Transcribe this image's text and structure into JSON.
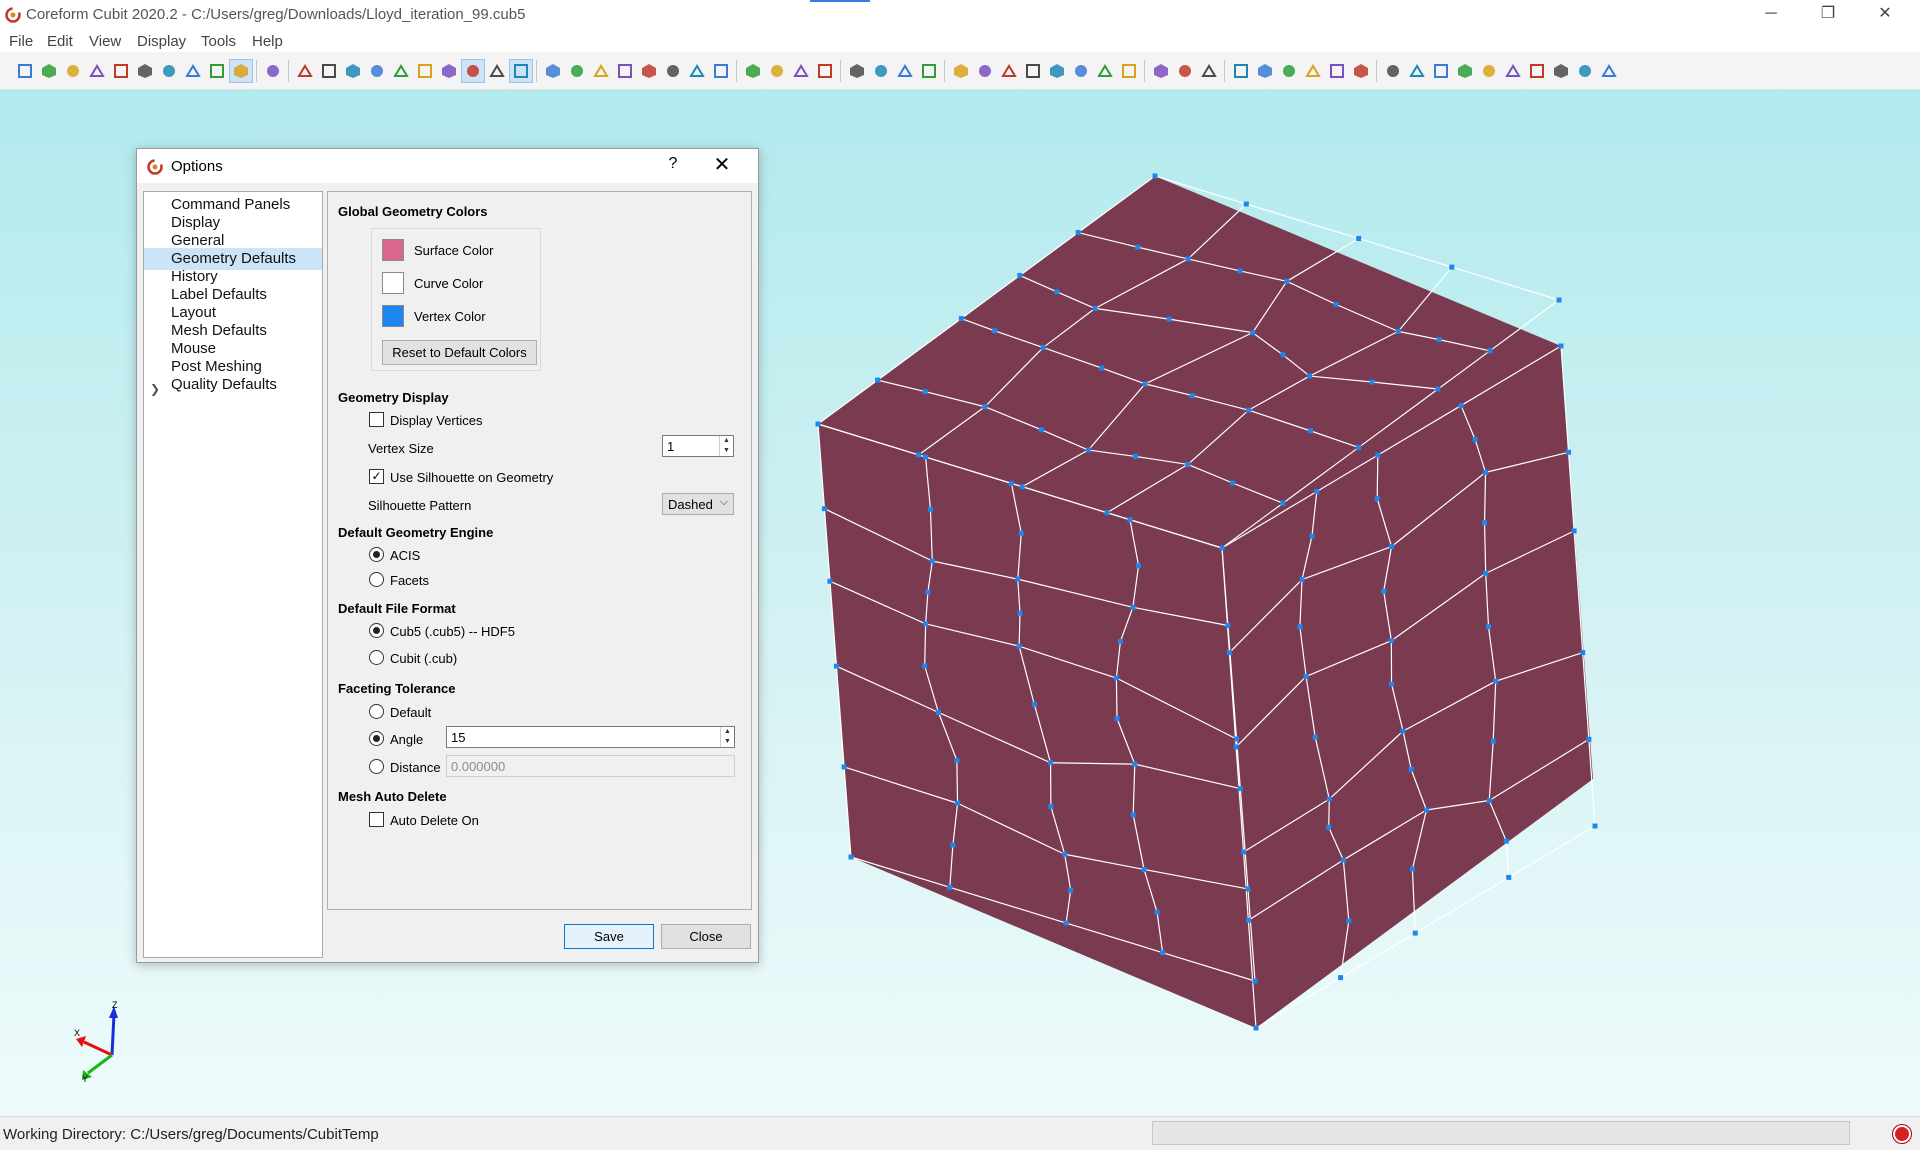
{
  "window": {
    "title": "Coreform Cubit 2020.2 - C:/Users/greg/Downloads/Lloyd_iteration_99.cub5",
    "min_label": "─",
    "max_label": "❐",
    "close_label": "✕"
  },
  "menu": [
    "File",
    "Edit",
    "View",
    "Display",
    "Tools",
    "Help"
  ],
  "toolbar_icons": [
    "new-file-icon",
    "open-folder-icon",
    "save-icon",
    "save-as-icon",
    "export-icon",
    "journal-icon",
    "play-icon",
    "record-icon",
    "tools-icon",
    "select-icon",
    "undo-icon",
    "wireframe-icon",
    "hidden-line-icon",
    "shaded-icon",
    "smooth-shade-icon",
    "assembly-icon",
    "mesh-view-icon",
    "geometry-view-icon",
    "grid-icon",
    "pick-volume-icon",
    "pick-surface-icon",
    "refresh-icon",
    "zoom-in-icon",
    "zoom-out-icon",
    "rotate-icon",
    "perspective-icon",
    "clip-icon",
    "face-icon",
    "volume-box-icon",
    "transparency-icon",
    "isometric-icon",
    "sphere-icon",
    "cylinder-icon",
    "brick-icon",
    "frustum-icon",
    "torus-icon",
    "boolean-icon",
    "vertex-pick-icon",
    "edge-pick-icon",
    "surface-pick-icon",
    "volume-pick-icon",
    "body-pick-icon",
    "group-pick-icon",
    "curve-icon",
    "point-icon",
    "add-vertex-icon",
    "add-curve-icon",
    "add-surface-icon",
    "add-volume-icon",
    "webcut-icon",
    "imprint-icon",
    "merge-icon",
    "split-icon",
    "measure-icon",
    "probe-icon",
    "sweep-icon",
    "label-icon",
    "quality-icon",
    "mesh-icon",
    "compare-icon",
    "fit-icon",
    "zoom-box-icon",
    "more-icon",
    "pin-icon"
  ],
  "status": {
    "working_directory": "Working Directory: C:/Users/greg/Documents/CubitTemp"
  },
  "dialog": {
    "title": "Options",
    "help_label": "?",
    "close_label": "✕",
    "nav": [
      {
        "label": "Command Panels",
        "selected": false
      },
      {
        "label": "Display",
        "selected": false
      },
      {
        "label": "General",
        "selected": false
      },
      {
        "label": "Geometry Defaults",
        "selected": true
      },
      {
        "label": "History",
        "selected": false
      },
      {
        "label": "Label Defaults",
        "selected": false
      },
      {
        "label": "Layout",
        "selected": false
      },
      {
        "label": "Mesh Defaults",
        "selected": false
      },
      {
        "label": "Mouse",
        "selected": false
      },
      {
        "label": "Post Meshing",
        "selected": false
      },
      {
        "label": "Quality Defaults",
        "selected": false,
        "expandable": true
      }
    ],
    "global_colors": {
      "heading": "Global Geometry Colors",
      "surface_label": "Surface Color",
      "surface_color": "#d9668c",
      "curve_label": "Curve Color",
      "curve_color": "#ffffff",
      "vertex_label": "Vertex Color",
      "vertex_color": "#1e86f0",
      "reset_label": "Reset to Default Colors"
    },
    "geometry_display": {
      "heading": "Geometry Display",
      "display_vertices_label": "Display Vertices",
      "display_vertices_checked": false,
      "vertex_size_label": "Vertex Size",
      "vertex_size_value": "1",
      "silhouette_label": "Use Silhouette on Geometry",
      "silhouette_checked": true,
      "pattern_label": "Silhouette Pattern",
      "pattern_value": "Dashed"
    },
    "engine": {
      "heading": "Default Geometry Engine",
      "options": [
        "ACIS",
        "Facets"
      ],
      "selected": "ACIS"
    },
    "file_format": {
      "heading": "Default File Format",
      "options": [
        "Cub5 (.cub5) -- HDF5",
        "Cubit (.cub)"
      ],
      "selected": "Cub5 (.cub5) -- HDF5"
    },
    "faceting": {
      "heading": "Faceting Tolerance",
      "default_label": "Default",
      "angle_label": "Angle",
      "angle_value": "15",
      "distance_label": "Distance",
      "distance_value": "0.000000",
      "selected": "Angle"
    },
    "auto_delete": {
      "heading": "Mesh Auto Delete",
      "label": "Auto Delete On",
      "checked": false
    },
    "save_label": "Save",
    "close_button_label": "Close"
  },
  "model": {
    "face_color": "#7a3a4f",
    "edge_color": "#ffffff",
    "vertex_color": "#1e86f0"
  },
  "axes": {
    "x_label": "X",
    "y_label": "Y",
    "z_label": "Z"
  }
}
